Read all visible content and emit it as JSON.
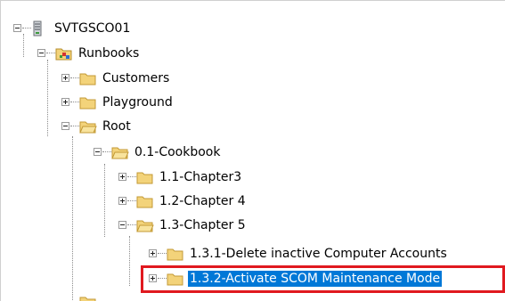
{
  "tree": {
    "nodes": [
      {
        "id": "server",
        "label": "SVTGSCO01",
        "icon": "server-icon",
        "state": "expanded"
      },
      {
        "id": "runbooks",
        "label": "Runbooks",
        "icon": "runbooks-folder-icon",
        "state": "expanded"
      },
      {
        "id": "customers",
        "label": "Customers",
        "icon": "folder-icon",
        "state": "collapsed"
      },
      {
        "id": "playground",
        "label": "Playground",
        "icon": "folder-icon",
        "state": "collapsed"
      },
      {
        "id": "root",
        "label": "Root",
        "icon": "folder-open-icon",
        "state": "expanded"
      },
      {
        "id": "cookbook",
        "label": "0.1-Cookbook",
        "icon": "folder-open-icon",
        "state": "expanded"
      },
      {
        "id": "chapter3",
        "label": "1.1-Chapter3",
        "icon": "folder-icon",
        "state": "collapsed"
      },
      {
        "id": "chapter4",
        "label": "1.2-Chapter 4",
        "icon": "folder-icon",
        "state": "collapsed"
      },
      {
        "id": "chapter5",
        "label": "1.3-Chapter 5",
        "icon": "folder-open-icon",
        "state": "expanded"
      },
      {
        "id": "delete-inactive",
        "label": "1.3.1-Delete inactive Computer Accounts",
        "icon": "folder-icon",
        "state": "collapsed"
      },
      {
        "id": "activate-scom",
        "label": "1.3.2-Activate SCOM Maintenance Mode",
        "icon": "folder-icon",
        "state": "collapsed",
        "selected": true
      }
    ]
  },
  "colors": {
    "selection": "#0078d7",
    "highlight_border": "#e0191f",
    "folder": "#f3d37a"
  }
}
